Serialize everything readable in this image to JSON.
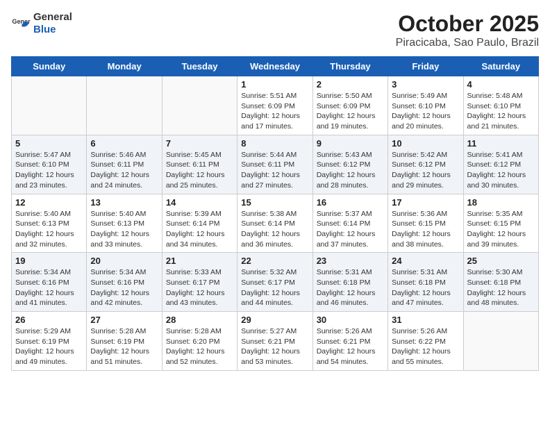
{
  "logo": {
    "general": "General",
    "blue": "Blue"
  },
  "title": "October 2025",
  "location": "Piracicaba, Sao Paulo, Brazil",
  "days_of_week": [
    "Sunday",
    "Monday",
    "Tuesday",
    "Wednesday",
    "Thursday",
    "Friday",
    "Saturday"
  ],
  "weeks": [
    [
      {
        "day": "",
        "sunrise": "",
        "sunset": "",
        "daylight": ""
      },
      {
        "day": "",
        "sunrise": "",
        "sunset": "",
        "daylight": ""
      },
      {
        "day": "",
        "sunrise": "",
        "sunset": "",
        "daylight": ""
      },
      {
        "day": "1",
        "sunrise": "Sunrise: 5:51 AM",
        "sunset": "Sunset: 6:09 PM",
        "daylight": "Daylight: 12 hours and 17 minutes."
      },
      {
        "day": "2",
        "sunrise": "Sunrise: 5:50 AM",
        "sunset": "Sunset: 6:09 PM",
        "daylight": "Daylight: 12 hours and 19 minutes."
      },
      {
        "day": "3",
        "sunrise": "Sunrise: 5:49 AM",
        "sunset": "Sunset: 6:10 PM",
        "daylight": "Daylight: 12 hours and 20 minutes."
      },
      {
        "day": "4",
        "sunrise": "Sunrise: 5:48 AM",
        "sunset": "Sunset: 6:10 PM",
        "daylight": "Daylight: 12 hours and 21 minutes."
      }
    ],
    [
      {
        "day": "5",
        "sunrise": "Sunrise: 5:47 AM",
        "sunset": "Sunset: 6:10 PM",
        "daylight": "Daylight: 12 hours and 23 minutes."
      },
      {
        "day": "6",
        "sunrise": "Sunrise: 5:46 AM",
        "sunset": "Sunset: 6:11 PM",
        "daylight": "Daylight: 12 hours and 24 minutes."
      },
      {
        "day": "7",
        "sunrise": "Sunrise: 5:45 AM",
        "sunset": "Sunset: 6:11 PM",
        "daylight": "Daylight: 12 hours and 25 minutes."
      },
      {
        "day": "8",
        "sunrise": "Sunrise: 5:44 AM",
        "sunset": "Sunset: 6:11 PM",
        "daylight": "Daylight: 12 hours and 27 minutes."
      },
      {
        "day": "9",
        "sunrise": "Sunrise: 5:43 AM",
        "sunset": "Sunset: 6:12 PM",
        "daylight": "Daylight: 12 hours and 28 minutes."
      },
      {
        "day": "10",
        "sunrise": "Sunrise: 5:42 AM",
        "sunset": "Sunset: 6:12 PM",
        "daylight": "Daylight: 12 hours and 29 minutes."
      },
      {
        "day": "11",
        "sunrise": "Sunrise: 5:41 AM",
        "sunset": "Sunset: 6:12 PM",
        "daylight": "Daylight: 12 hours and 30 minutes."
      }
    ],
    [
      {
        "day": "12",
        "sunrise": "Sunrise: 5:40 AM",
        "sunset": "Sunset: 6:13 PM",
        "daylight": "Daylight: 12 hours and 32 minutes."
      },
      {
        "day": "13",
        "sunrise": "Sunrise: 5:40 AM",
        "sunset": "Sunset: 6:13 PM",
        "daylight": "Daylight: 12 hours and 33 minutes."
      },
      {
        "day": "14",
        "sunrise": "Sunrise: 5:39 AM",
        "sunset": "Sunset: 6:14 PM",
        "daylight": "Daylight: 12 hours and 34 minutes."
      },
      {
        "day": "15",
        "sunrise": "Sunrise: 5:38 AM",
        "sunset": "Sunset: 6:14 PM",
        "daylight": "Daylight: 12 hours and 36 minutes."
      },
      {
        "day": "16",
        "sunrise": "Sunrise: 5:37 AM",
        "sunset": "Sunset: 6:14 PM",
        "daylight": "Daylight: 12 hours and 37 minutes."
      },
      {
        "day": "17",
        "sunrise": "Sunrise: 5:36 AM",
        "sunset": "Sunset: 6:15 PM",
        "daylight": "Daylight: 12 hours and 38 minutes."
      },
      {
        "day": "18",
        "sunrise": "Sunrise: 5:35 AM",
        "sunset": "Sunset: 6:15 PM",
        "daylight": "Daylight: 12 hours and 39 minutes."
      }
    ],
    [
      {
        "day": "19",
        "sunrise": "Sunrise: 5:34 AM",
        "sunset": "Sunset: 6:16 PM",
        "daylight": "Daylight: 12 hours and 41 minutes."
      },
      {
        "day": "20",
        "sunrise": "Sunrise: 5:34 AM",
        "sunset": "Sunset: 6:16 PM",
        "daylight": "Daylight: 12 hours and 42 minutes."
      },
      {
        "day": "21",
        "sunrise": "Sunrise: 5:33 AM",
        "sunset": "Sunset: 6:17 PM",
        "daylight": "Daylight: 12 hours and 43 minutes."
      },
      {
        "day": "22",
        "sunrise": "Sunrise: 5:32 AM",
        "sunset": "Sunset: 6:17 PM",
        "daylight": "Daylight: 12 hours and 44 minutes."
      },
      {
        "day": "23",
        "sunrise": "Sunrise: 5:31 AM",
        "sunset": "Sunset: 6:18 PM",
        "daylight": "Daylight: 12 hours and 46 minutes."
      },
      {
        "day": "24",
        "sunrise": "Sunrise: 5:31 AM",
        "sunset": "Sunset: 6:18 PM",
        "daylight": "Daylight: 12 hours and 47 minutes."
      },
      {
        "day": "25",
        "sunrise": "Sunrise: 5:30 AM",
        "sunset": "Sunset: 6:18 PM",
        "daylight": "Daylight: 12 hours and 48 minutes."
      }
    ],
    [
      {
        "day": "26",
        "sunrise": "Sunrise: 5:29 AM",
        "sunset": "Sunset: 6:19 PM",
        "daylight": "Daylight: 12 hours and 49 minutes."
      },
      {
        "day": "27",
        "sunrise": "Sunrise: 5:28 AM",
        "sunset": "Sunset: 6:19 PM",
        "daylight": "Daylight: 12 hours and 51 minutes."
      },
      {
        "day": "28",
        "sunrise": "Sunrise: 5:28 AM",
        "sunset": "Sunset: 6:20 PM",
        "daylight": "Daylight: 12 hours and 52 minutes."
      },
      {
        "day": "29",
        "sunrise": "Sunrise: 5:27 AM",
        "sunset": "Sunset: 6:21 PM",
        "daylight": "Daylight: 12 hours and 53 minutes."
      },
      {
        "day": "30",
        "sunrise": "Sunrise: 5:26 AM",
        "sunset": "Sunset: 6:21 PM",
        "daylight": "Daylight: 12 hours and 54 minutes."
      },
      {
        "day": "31",
        "sunrise": "Sunrise: 5:26 AM",
        "sunset": "Sunset: 6:22 PM",
        "daylight": "Daylight: 12 hours and 55 minutes."
      },
      {
        "day": "",
        "sunrise": "",
        "sunset": "",
        "daylight": ""
      }
    ]
  ]
}
